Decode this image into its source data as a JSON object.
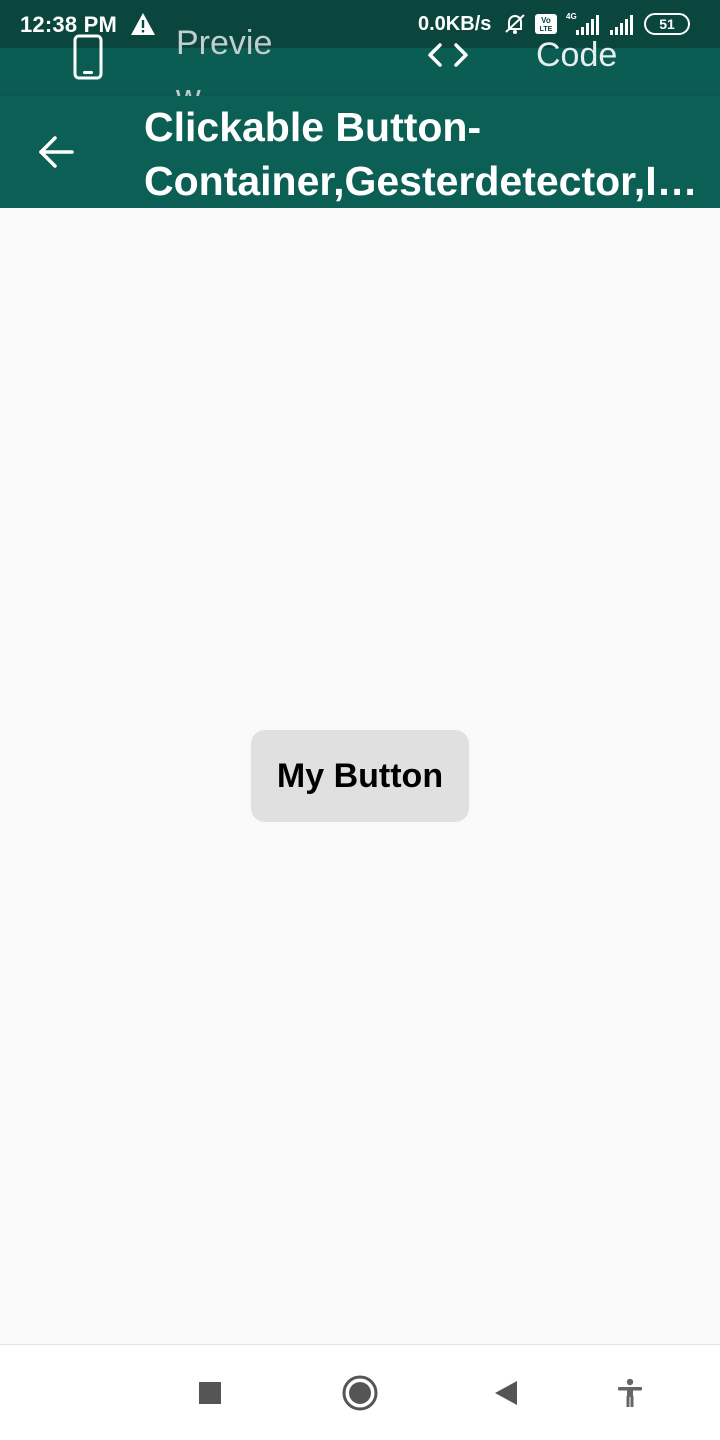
{
  "status_bar": {
    "time": "12:38 PM",
    "speed": "0.0KB/s",
    "battery": "51",
    "icons": [
      "warning-icon",
      "mute-icon",
      "volte-icon",
      "signal-4g-icon",
      "signal-icon",
      "battery-icon"
    ]
  },
  "toggle_bar": {
    "preview_label": "Preview",
    "code_label": "Code"
  },
  "app_bar": {
    "title": "Clickable Button-Container,Gesterdetector,Inkwell"
  },
  "main": {
    "button_label": "My Button"
  },
  "nav_bar": {
    "items": [
      "recents-icon",
      "home-icon",
      "back-icon",
      "accessibility-icon"
    ]
  },
  "colors": {
    "status_bar": "#0a463e",
    "toggle_bar": "#0b5c52",
    "app_bar": "#0b5f55",
    "background": "#f9f9f9",
    "button": "#e0e0e0"
  }
}
